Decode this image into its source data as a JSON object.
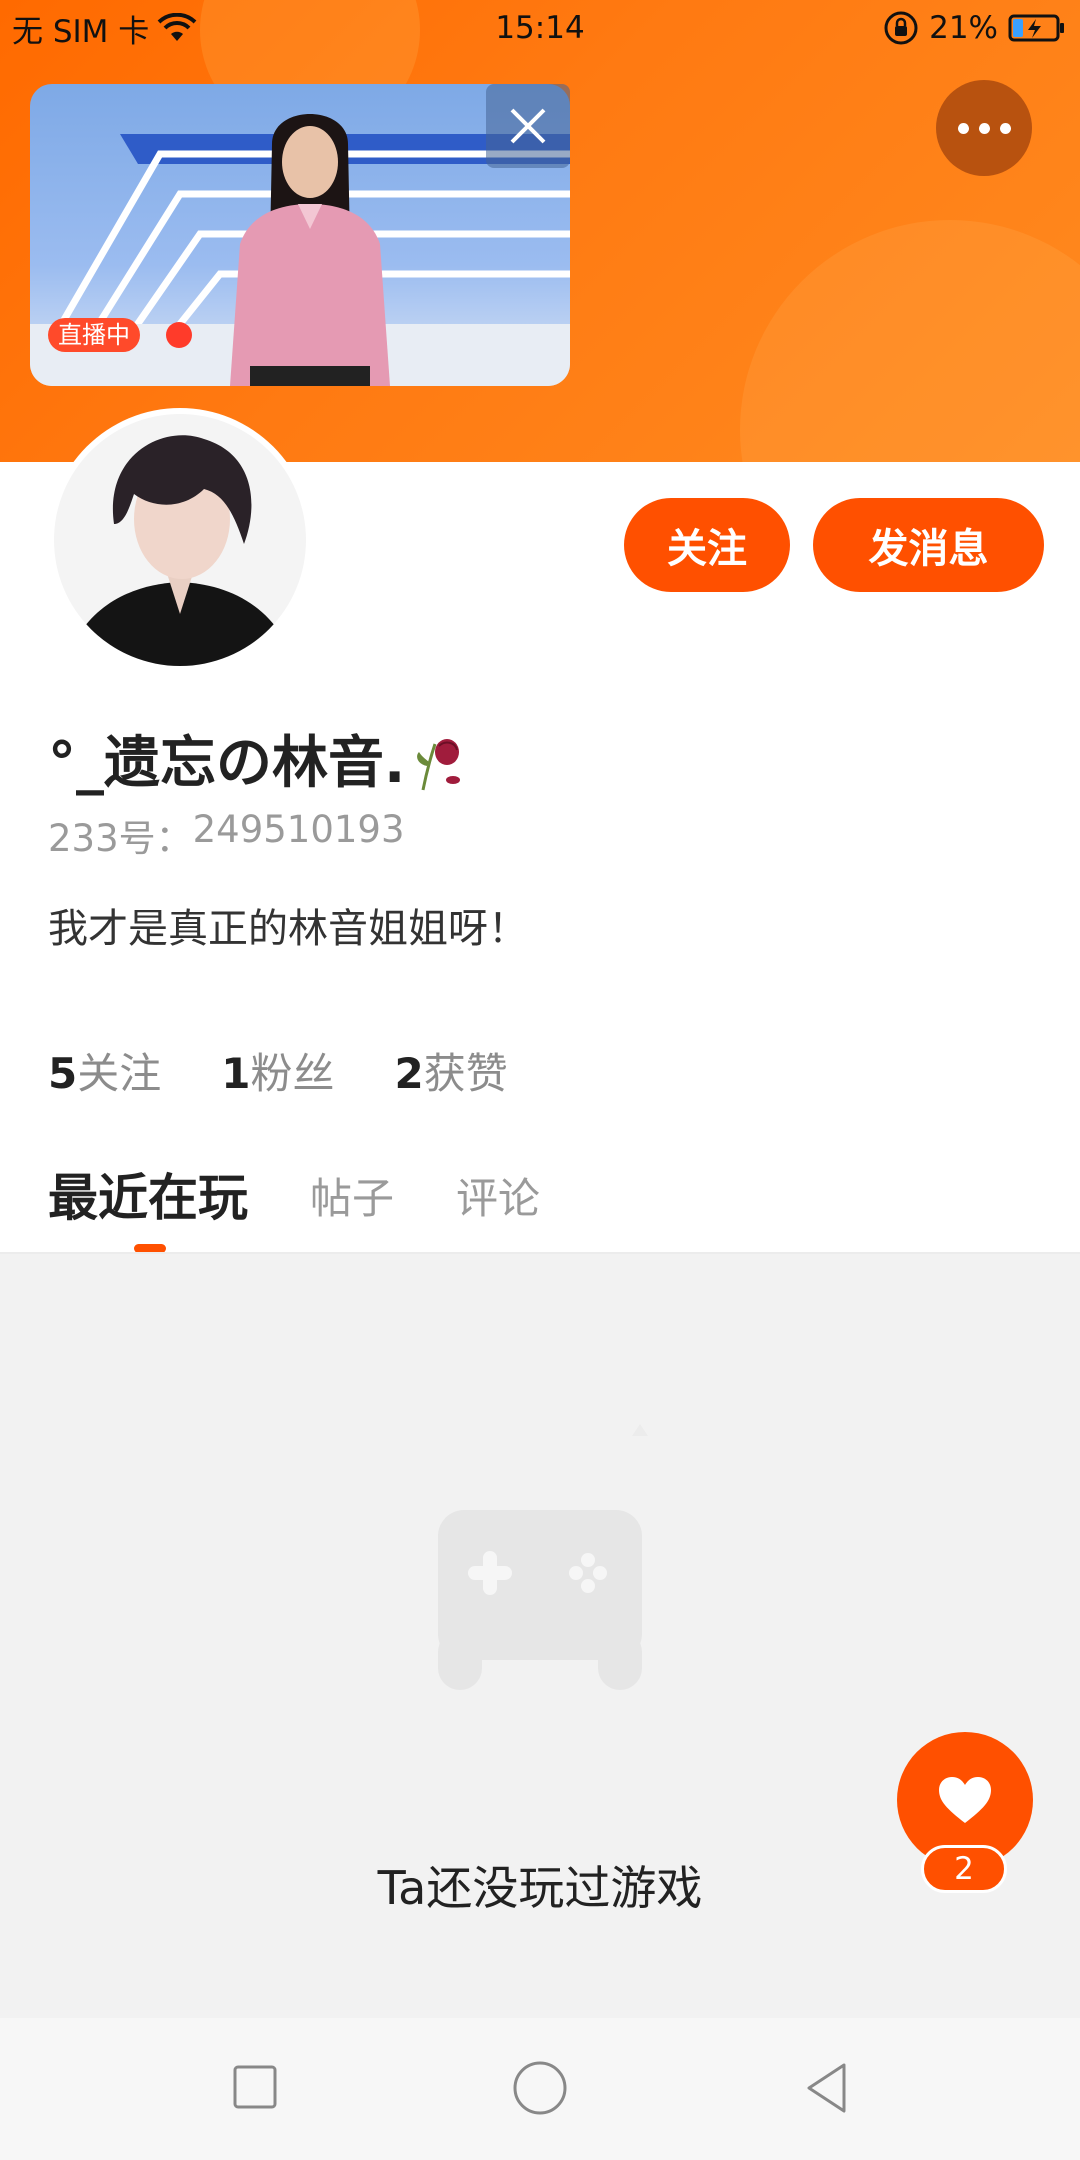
{
  "status_bar": {
    "carrier": "无 SIM 卡",
    "time": "15:14",
    "battery": "21%"
  },
  "live": {
    "badge": "直播中"
  },
  "profile": {
    "nickname": "°_遗忘の林音.",
    "uid_label": "233号：",
    "uid_value": "249510193",
    "bio": "我才是真正的林音姐姐呀！"
  },
  "actions": {
    "follow": "关注",
    "message": "发消息"
  },
  "stats": [
    {
      "num": "5",
      "label": "关注"
    },
    {
      "num": "1",
      "label": "粉丝"
    },
    {
      "num": "2",
      "label": "获赞"
    }
  ],
  "tabs": {
    "active": "最近在玩",
    "posts": "帖子",
    "comments": "评论"
  },
  "empty_state": {
    "text": "Ta还没玩过游戏"
  },
  "like": {
    "count": "2"
  },
  "colors": {
    "accent": "#ff5000",
    "header": "#ff7a12"
  }
}
